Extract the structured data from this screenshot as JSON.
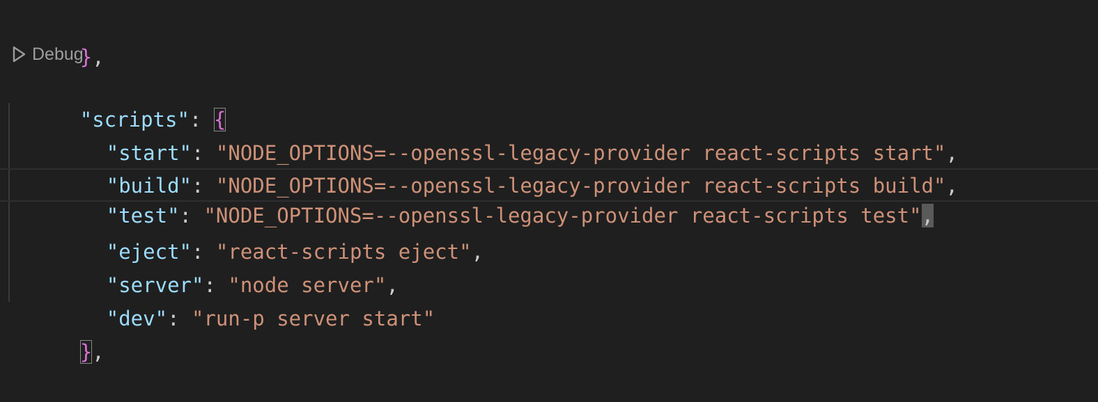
{
  "editor": {
    "lines": [
      {
        "parts": [
          {
            "t": "}",
            "c": "brace"
          },
          {
            "t": ",",
            "c": "punc"
          }
        ]
      },
      {
        "parts": [
          {
            "t": "\"scripts\"",
            "c": "key"
          },
          {
            "t": ": ",
            "c": "punc"
          },
          {
            "t": "{",
            "c": "brace"
          }
        ]
      },
      {
        "parts": [
          {
            "t": "\"start\"",
            "c": "key"
          },
          {
            "t": ": ",
            "c": "punc"
          },
          {
            "t": "\"NODE_OPTIONS=--openssl-legacy-provider react-scripts start\"",
            "c": "str"
          },
          {
            "t": ",",
            "c": "punc"
          }
        ]
      },
      {
        "parts": [
          {
            "t": "\"build\"",
            "c": "key"
          },
          {
            "t": ": ",
            "c": "punc"
          },
          {
            "t": "\"NODE_OPTIONS=--openssl-legacy-provider react-scripts build\"",
            "c": "str"
          },
          {
            "t": ",",
            "c": "punc"
          }
        ]
      },
      {
        "parts": [
          {
            "t": "\"test\"",
            "c": "key"
          },
          {
            "t": ": ",
            "c": "punc"
          },
          {
            "t": "\"NODE_OPTIONS=--openssl-legacy-provider react-scripts test\"",
            "c": "str"
          },
          {
            "t": ",",
            "c": "punc"
          }
        ]
      },
      {
        "parts": [
          {
            "t": "\"eject\"",
            "c": "key"
          },
          {
            "t": ": ",
            "c": "punc"
          },
          {
            "t": "\"react-scripts eject\"",
            "c": "str"
          },
          {
            "t": ",",
            "c": "punc"
          }
        ]
      },
      {
        "parts": [
          {
            "t": "\"server\"",
            "c": "key"
          },
          {
            "t": ": ",
            "c": "punc"
          },
          {
            "t": "\"node server\"",
            "c": "str"
          },
          {
            "t": ",",
            "c": "punc"
          }
        ]
      },
      {
        "parts": [
          {
            "t": "\"dev\"",
            "c": "key"
          },
          {
            "t": ": ",
            "c": "punc"
          },
          {
            "t": "\"run-p server start\"",
            "c": "str"
          }
        ]
      },
      {
        "parts": [
          {
            "t": "}",
            "c": "brace"
          },
          {
            "t": ",",
            "c": "punc"
          }
        ]
      }
    ]
  },
  "codelens": {
    "icon": "play-outline-icon",
    "label": "Debug"
  },
  "colors": {
    "background": "#1f1f1f",
    "key": "#9cdcfe",
    "string": "#ce9178",
    "brace": "#da70d6",
    "codelens": "#9d9d9d"
  }
}
